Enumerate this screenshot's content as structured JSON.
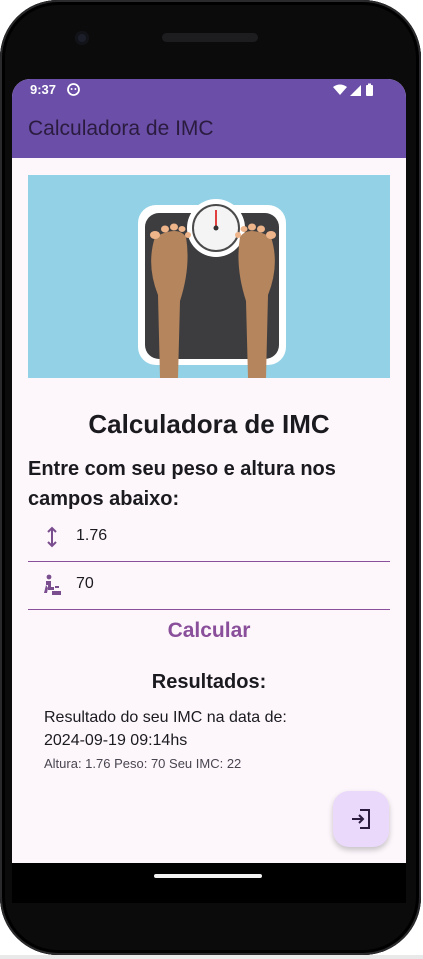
{
  "status_bar": {
    "time": "9:37"
  },
  "app_bar": {
    "title": "Calculadora de IMC"
  },
  "content": {
    "page_title": "Calculadora de IMC",
    "instructions": "Entre com seu peso e altura nos campos abaixo:",
    "height_field": {
      "value": "1.76",
      "icon": "height-arrows-icon"
    },
    "weight_field": {
      "value": "70",
      "icon": "scale-person-icon"
    },
    "calculate_label": "Calcular",
    "results_title": "Resultados:",
    "result_line1": "Resultado do seu IMC na data de:",
    "result_line2": "2024-09-19 09:14hs",
    "result_detail": "Altura: 1.76 Peso: 70 Seu IMC: 22"
  },
  "fab": {
    "icon": "logout-icon"
  },
  "colors": {
    "app_bar": "#6a4ea8",
    "accent": "#8a4f9a",
    "screen_bg": "#fdf7fc",
    "fab_bg": "#ead9fb",
    "hero_bg": "#93d1e6"
  }
}
